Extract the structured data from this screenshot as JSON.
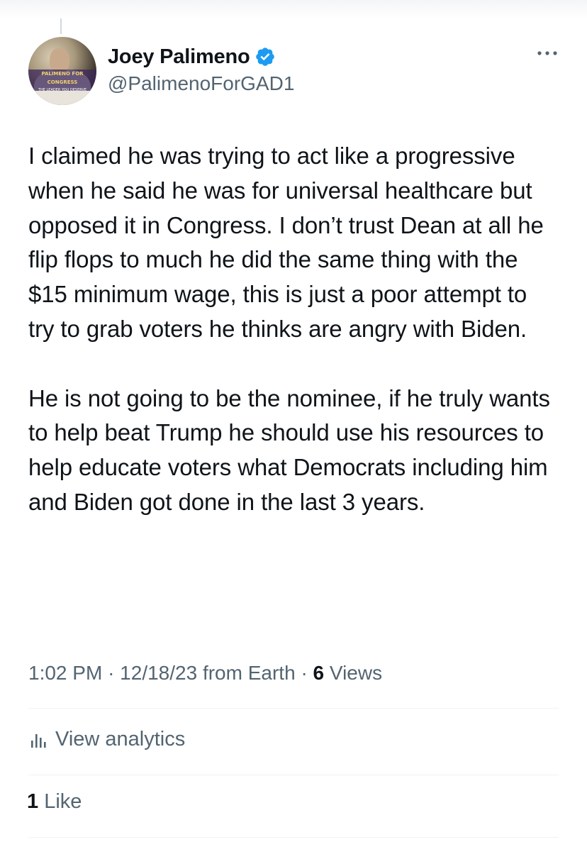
{
  "author": {
    "display_name": "Joey Palimeno",
    "handle": "@PalimenoForGAD1",
    "verified": true,
    "avatar": {
      "banner_text": "PALIMENO FOR CONGRESS",
      "banner_subtext": "THE LEADER YOU DESERVE"
    }
  },
  "tweet": {
    "paragraphs": [
      "I claimed he was trying to act like a progressive when he said he was for universal healthcare but opposed it in Congress. I don’t trust Dean at all he flip flops to much he did the same thing with the $15 minimum wage, this is just a poor attempt to try to grab voters he thinks are angry with Biden.",
      "He is not going to be the nominee, if he truly wants to help beat Trump he should use his resources to help educate voters what Democrats including him and Biden got done in the last 3 years."
    ]
  },
  "meta": {
    "time": "1:02 PM",
    "date": "12/18/23",
    "source": "from Earth",
    "separator": "·",
    "views_count": "6",
    "views_label": "Views"
  },
  "analytics": {
    "label": "View analytics"
  },
  "likes": {
    "count": "1",
    "label": "Like"
  },
  "colors": {
    "text_primary": "#0f1419",
    "text_secondary": "#536471",
    "verified_blue": "#1d9bf0",
    "divider": "#eff3f4"
  },
  "icons": {
    "verified": "verified-badge-icon",
    "more": "more-options-icon",
    "analytics": "analytics-bars-icon"
  }
}
